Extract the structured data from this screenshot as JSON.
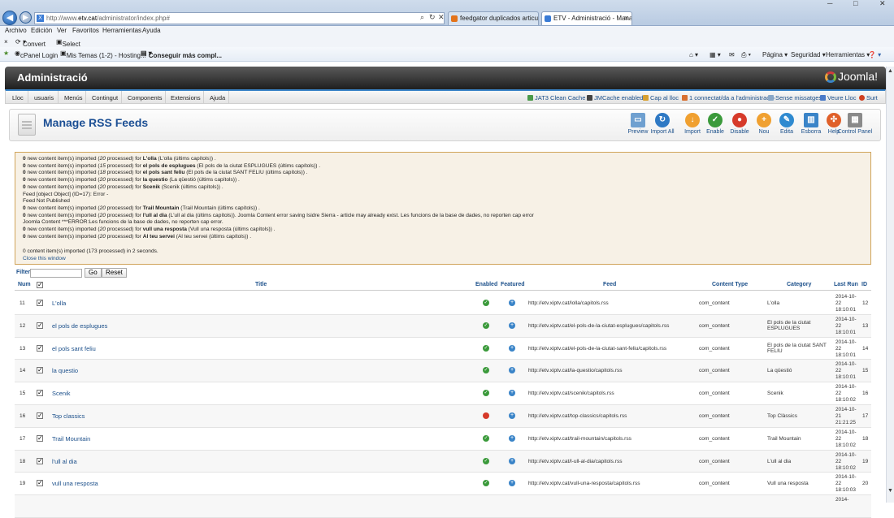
{
  "browser": {
    "url_prefix": "http://www.",
    "url_host": "etv.cat",
    "url_path": "/administrator/index.php#",
    "tabs": [
      {
        "label": "feedgator duplicados articulos ..."
      },
      {
        "label": "ETV - Administració - Mana..."
      }
    ],
    "nav_back": "◀",
    "nav_forward": "▶",
    "fav_glyph": "X",
    "search_glyph": "⌕",
    "refresh_glyph": "↻",
    "stop_glyph": "✕",
    "tab_close": "✕"
  },
  "window": {
    "ctl": [
      "─",
      "□",
      "✕"
    ]
  },
  "menubar": [
    "Archivo",
    "Edición",
    "Ver",
    "Favoritos",
    "Herramientas",
    "Ayuda"
  ],
  "cmdbar": {
    "close": "×",
    "convert": "Convert",
    "select": "Select"
  },
  "favbar": {
    "items": [
      "cPanel Login",
      "Mis Temas (1-2) - Hosting...",
      "Conseguir más compl..."
    ],
    "tools": [
      "Página ▾",
      "Seguridad ▾",
      "Herramientas ▾"
    ]
  },
  "joomla": {
    "header_title": "Administració",
    "logo_text": "Joomla!"
  },
  "jmenu": [
    "Lloc",
    "usuaris",
    "Menús",
    "Contingut",
    "Components",
    "Extensions",
    "Ajuda"
  ],
  "status": [
    "JAT3 Clean Cache",
    "JMCache enabled",
    "Cap al lloc",
    "1 connectat/da a l'administració",
    "Sense missatges",
    "Veure Lloc",
    "Surt"
  ],
  "toolbar": {
    "title": "Manage RSS Feeds",
    "buttons": [
      {
        "label": "Preview",
        "icon": "preview-icon",
        "color": "#6fa0d0",
        "glyph": "▭"
      },
      {
        "label": "Import All",
        "icon": "refresh-icon",
        "color": "#2f79c4",
        "glyph": "↻"
      },
      {
        "label": "Import",
        "icon": "import-icon",
        "color": "#f0a030",
        "glyph": "↓"
      },
      {
        "label": "Enable",
        "icon": "check-icon",
        "color": "#3b9a3b",
        "glyph": "✓"
      },
      {
        "label": "Disable",
        "icon": "disable-icon",
        "color": "#d63a2a",
        "glyph": "●"
      },
      {
        "label": "Nou",
        "icon": "plus-icon",
        "color": "#f0a030",
        "glyph": "+"
      },
      {
        "label": "Edita",
        "icon": "pencil-icon",
        "color": "#2f8ad0",
        "glyph": "✎"
      },
      {
        "label": "Esborra",
        "icon": "trash-icon",
        "color": "#3a84c8",
        "glyph": "▥"
      },
      {
        "label": "Help",
        "icon": "help-icon",
        "color": "#e0602a",
        "glyph": "✣"
      },
      {
        "label": "Control Panel",
        "icon": "control-panel-icon",
        "color": "#8a8a8a",
        "glyph": "▦"
      }
    ]
  },
  "messages": [
    {
      "n": "0",
      "pre": " new content item(s) imported (",
      "c": "20",
      "mid": " processed) for ",
      "name": "L'olla",
      "post": " (L'olla (últims capítols)) ."
    },
    {
      "n": "0",
      "pre": " new content item(s) imported (",
      "c": "15",
      "mid": " processed) for ",
      "name": "el pols de esplugues",
      "post": " (El pols de la ciutat ESPLUGUES (últims capítols)) ."
    },
    {
      "n": "0",
      "pre": " new content item(s) imported (",
      "c": "18",
      "mid": " processed) for ",
      "name": "el pols sant feliu",
      "post": " (El pols de la ciutat SANT FELIU (últims capítols)) ."
    },
    {
      "n": "0",
      "pre": " new content item(s) imported (",
      "c": "20",
      "mid": " processed) for ",
      "name": "la questio",
      "post": " (La qüestió (últims capítols)) ."
    },
    {
      "n": "0",
      "pre": " new content item(s) imported (",
      "c": "20",
      "mid": " processed) for ",
      "name": "Scenik",
      "post": " (Scenik (últims capítols)) ."
    },
    {
      "plain": "Feed [object Object] (ID=17): Error -"
    },
    {
      "plain": "Feed Not Published"
    },
    {
      "n": "0",
      "pre": " new content item(s) imported (",
      "c": "20",
      "mid": " processed) for ",
      "name": "Trail Mountain",
      "post": " (Trail Mountain (últims capítols)) ."
    },
    {
      "n": "0",
      "pre": " new content item(s) imported (",
      "c": "20",
      "mid": " processed) for ",
      "name": "l'ull al dia",
      "post": " (L'ull al dia (últims capítols)). Joomla Content error saving Isidre Sierra - article may already exist. Les funcions de la base de dades, no reporten cap error"
    },
    {
      "plain": "Joomla Content ***ERROR:Les funcions de la base de dades, no reporten cap error."
    },
    {
      "n": "0",
      "pre": " new content item(s) imported (",
      "c": "20",
      "mid": " processed) for ",
      "name": "vull una resposta",
      "post": " (Vull una resposta (últims capítols)) ."
    },
    {
      "n": "0",
      "pre": " new content item(s) imported (",
      "c": "20",
      "mid": " processed) for ",
      "name": "Al teu servei",
      "post": " (Al teu servei (últims capítols)) ."
    }
  ],
  "summary": "0 content item(s) imported (173 processed) in 2 seconds.",
  "close_window": "Close this window",
  "filter": {
    "label": "Filter:",
    "go": "Go",
    "reset": "Reset"
  },
  "columns": {
    "num": "Num",
    "title": "Title",
    "enabled": "Enabled",
    "featured": "Featured",
    "feed": "Feed",
    "content_type": "Content Type",
    "category": "Category",
    "last_run": "Last Run",
    "id": "ID"
  },
  "check_glyph": "✓",
  "featured_glyph": "+",
  "rows": [
    {
      "num": "11",
      "title": "L'olla",
      "enabled": true,
      "feed": "http://etv.xiptv.cat/lolla/capitols.rss",
      "ctype": "com_content",
      "category": "L'olla",
      "last_run": "2014-10-22 18:10:01",
      "id": "12"
    },
    {
      "num": "12",
      "title": "el pols de esplugues",
      "enabled": true,
      "feed": "http://etv.xiptv.cat/el-pols-de-la-ciutat-esplugues/capitols.rss",
      "ctype": "com_content",
      "category": "El pols de la ciutat ESPLUGUES",
      "last_run": "2014-10-22 18:10:01",
      "id": "13"
    },
    {
      "num": "13",
      "title": "el pols sant feliu",
      "enabled": true,
      "feed": "http://etv.xiptv.cat/el-pols-de-la-ciutat-sant-feliu/capitols.rss",
      "ctype": "com_content",
      "category": "El pols de la ciutat SANT FELIU",
      "last_run": "2014-10-22 18:10:01",
      "id": "14"
    },
    {
      "num": "14",
      "title": "la questio",
      "enabled": true,
      "feed": "http://etv.xiptv.cat/la-questio/capitols.rss",
      "ctype": "com_content",
      "category": "La qüestió",
      "last_run": "2014-10-22 18:10:01",
      "id": "15"
    },
    {
      "num": "15",
      "title": "Scenik",
      "enabled": true,
      "feed": "http://etv.xiptv.cat/scenik/capitols.rss",
      "ctype": "com_content",
      "category": "Scenik",
      "last_run": "2014-10-22 18:10:02",
      "id": "16"
    },
    {
      "num": "16",
      "title": "Top classics",
      "enabled": false,
      "feed": "http://etv.xiptv.cat/top-classics/capitols.rss",
      "ctype": "com_content",
      "category": "Top Clàssics",
      "last_run": "2014-10-21 21:21:25",
      "id": "17"
    },
    {
      "num": "17",
      "title": "Trail Mountain",
      "enabled": true,
      "feed": "http://etv.xiptv.cat/trail-mountain/capitols.rss",
      "ctype": "com_content",
      "category": "Trail Mountain",
      "last_run": "2014-10-22 18:10:02",
      "id": "18"
    },
    {
      "num": "18",
      "title": "l'ull al dia",
      "enabled": true,
      "feed": "http://etv.xiptv.cat/l-ull-al-dia/capitols.rss",
      "ctype": "com_content",
      "category": "L'ull al dia",
      "last_run": "2014-10-22 18:10:02",
      "id": "19"
    },
    {
      "num": "19",
      "title": "vull una resposta",
      "enabled": true,
      "feed": "http://etv.xiptv.cat/vull-una-resposta/capitols.rss",
      "ctype": "com_content",
      "category": "Vull una resposta",
      "last_run": "2014-10-22 18:10:03",
      "id": "20"
    },
    {
      "num": "",
      "title": "",
      "enabled": null,
      "feed": "",
      "ctype": "",
      "category": "",
      "last_run": "2014-",
      "id": ""
    }
  ],
  "colors": {
    "accent": "#1b4f8a",
    "enabled": "#3b9a3b",
    "disabled": "#d63a2a",
    "featured": "#3a84c8"
  },
  "scroll": {
    "up": "▲",
    "down": "▼"
  }
}
